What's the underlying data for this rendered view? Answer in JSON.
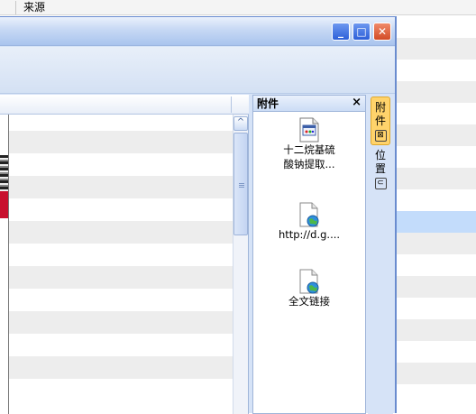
{
  "background_list": {
    "column_header": "来源"
  },
  "window": {
    "title_buttons": {
      "minimize": "_",
      "maximize": "□",
      "close": "✕"
    }
  },
  "grid": {
    "scroll_up_glyph": "^"
  },
  "attachments_panel": {
    "title": "附件",
    "close_glyph": "×",
    "items": [
      {
        "label_line1": "十二烷基硫",
        "label_line2": "酸钠提取...",
        "icon": "image-file-icon"
      },
      {
        "label_line1": "http://d.g....",
        "icon": "web-link-file-icon"
      },
      {
        "label_line1": "全文链接",
        "icon": "web-link-file-icon"
      }
    ]
  },
  "side_tabs": [
    {
      "label_top": "附",
      "label_bottom": "件",
      "active": true
    },
    {
      "label_top": "位",
      "label_bottom": "置",
      "active": false
    }
  ],
  "colors": {
    "accent": "#6a8ccf",
    "selected_row": "#c3dcfb",
    "active_tab": "#ffd36b",
    "close_button": "#d24b26"
  }
}
